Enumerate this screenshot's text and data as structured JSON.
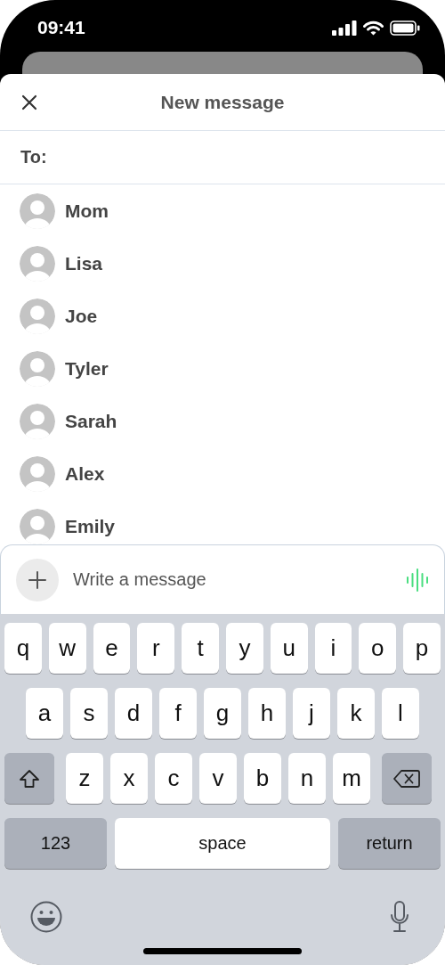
{
  "status_bar": {
    "time": "09:41"
  },
  "header": {
    "title": "New message"
  },
  "recipient": {
    "label": "To:"
  },
  "contacts": [
    {
      "name": "Mom"
    },
    {
      "name": "Lisa"
    },
    {
      "name": "Joe"
    },
    {
      "name": "Tyler"
    },
    {
      "name": "Sarah"
    },
    {
      "name": "Alex"
    },
    {
      "name": "Emily"
    }
  ],
  "composer": {
    "placeholder": "Write a message"
  },
  "keyboard": {
    "rows": [
      [
        {
          "kind": "letter",
          "label": "q"
        },
        {
          "kind": "letter",
          "label": "w"
        },
        {
          "kind": "letter",
          "label": "e"
        },
        {
          "kind": "letter",
          "label": "r"
        },
        {
          "kind": "letter",
          "label": "t"
        },
        {
          "kind": "letter",
          "label": "y"
        },
        {
          "kind": "letter",
          "label": "u"
        },
        {
          "kind": "letter",
          "label": "i"
        },
        {
          "kind": "letter",
          "label": "o"
        },
        {
          "kind": "letter",
          "label": "p"
        }
      ],
      [
        {
          "kind": "letter",
          "label": "a"
        },
        {
          "kind": "letter",
          "label": "s"
        },
        {
          "kind": "letter",
          "label": "d"
        },
        {
          "kind": "letter",
          "label": "f"
        },
        {
          "kind": "letter",
          "label": "g"
        },
        {
          "kind": "letter",
          "label": "h"
        },
        {
          "kind": "letter",
          "label": "j"
        },
        {
          "kind": "letter",
          "label": "k"
        },
        {
          "kind": "letter",
          "label": "l"
        }
      ],
      [
        {
          "kind": "shift"
        },
        {
          "kind": "letter",
          "label": "z"
        },
        {
          "kind": "letter",
          "label": "x"
        },
        {
          "kind": "letter",
          "label": "c"
        },
        {
          "kind": "letter",
          "label": "v"
        },
        {
          "kind": "letter",
          "label": "b"
        },
        {
          "kind": "letter",
          "label": "n"
        },
        {
          "kind": "letter",
          "label": "m"
        },
        {
          "kind": "delete"
        }
      ]
    ],
    "function_keys": [
      {
        "kind": "mode",
        "label": "123"
      },
      {
        "kind": "space",
        "label": "space"
      },
      {
        "kind": "return",
        "label": "return"
      }
    ]
  }
}
